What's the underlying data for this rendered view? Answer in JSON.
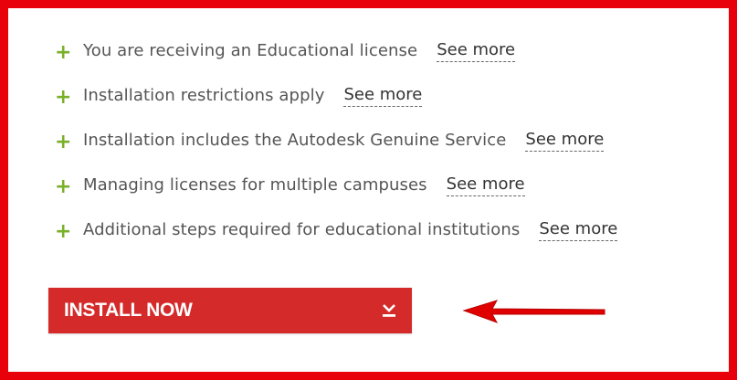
{
  "license_info": {
    "items": [
      {
        "text": "You are receiving an Educational license",
        "link": "See more"
      },
      {
        "text": "Installation restrictions apply",
        "link": "See more"
      },
      {
        "text": "Installation includes the Autodesk Genuine Service",
        "link": "See more"
      },
      {
        "text": "Managing licenses for multiple campuses",
        "link": "See more"
      },
      {
        "text": "Additional steps required for educational institutions",
        "link": "See more"
      }
    ]
  },
  "install_button": {
    "label": "INSTALL NOW",
    "icon": "download-chevron-icon"
  },
  "colors": {
    "highlight_border": "#e8000a",
    "button_bg": "#d42a2a",
    "plus_icon": "#7ab02a",
    "annotation_arrow": "#e00000"
  }
}
